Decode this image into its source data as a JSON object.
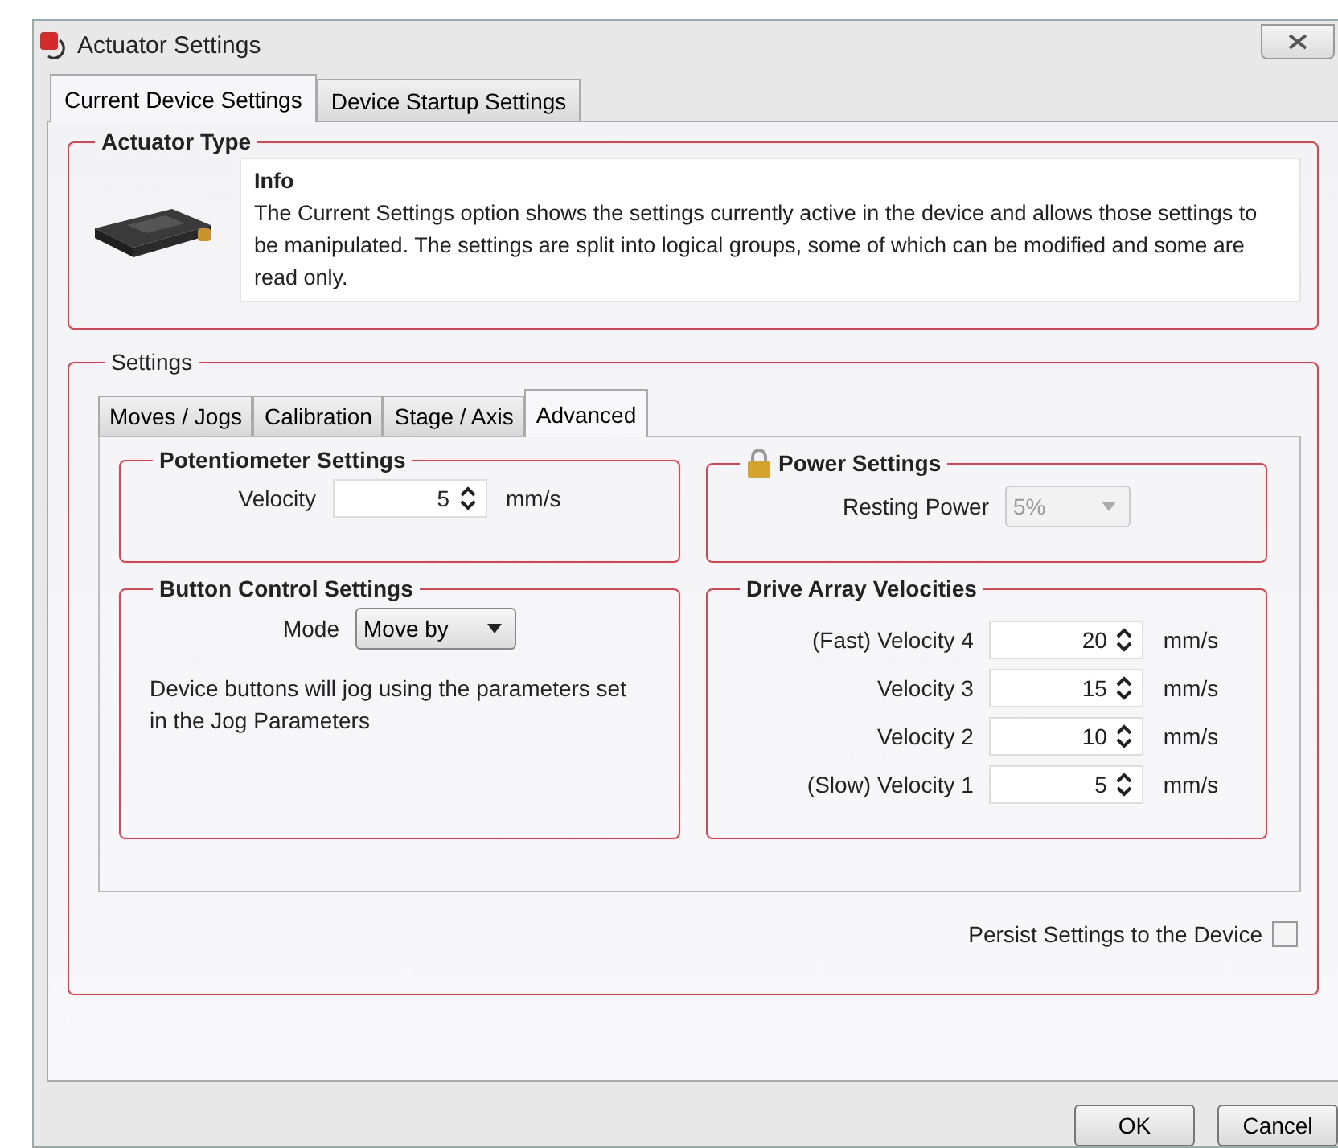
{
  "window": {
    "title": "Actuator Settings"
  },
  "tabs": [
    {
      "label": "Current Device Settings",
      "selected": true
    },
    {
      "label": "Device Startup Settings",
      "selected": false
    }
  ],
  "actuator_type": {
    "title": "Actuator Type",
    "info_title": "Info",
    "info_text": "The Current Settings option shows the settings currently active in the device and allows those settings to be manipulated. The settings are split into logical groups, some of which can be modified and some are read only."
  },
  "settings": {
    "title": "Settings",
    "tabs": [
      {
        "label": "Moves / Jogs",
        "selected": false
      },
      {
        "label": "Calibration",
        "selected": false
      },
      {
        "label": "Stage / Axis",
        "selected": false
      },
      {
        "label": "Advanced",
        "selected": true
      }
    ],
    "potentiometer": {
      "title": "Potentiometer Settings",
      "label": "Velocity",
      "value": "5",
      "unit": "mm/s"
    },
    "power": {
      "title": "Power Settings",
      "locked": true,
      "label": "Resting Power",
      "value": "5%",
      "disabled": true
    },
    "button_control": {
      "title": "Button Control Settings",
      "label": "Mode",
      "value": "Move by",
      "description": "Device buttons will jog using the parameters set in the Jog Parameters"
    },
    "drive_array": {
      "title": "Drive Array Velocities",
      "rows": [
        {
          "label": "(Fast) Velocity 4",
          "value": "20",
          "unit": "mm/s"
        },
        {
          "label": "Velocity 3",
          "value": "15",
          "unit": "mm/s"
        },
        {
          "label": "Velocity 2",
          "value": "10",
          "unit": "mm/s"
        },
        {
          "label": "(Slow) Velocity 1",
          "value": "5",
          "unit": "mm/s"
        }
      ]
    },
    "persist": {
      "label": "Persist Settings to the Device",
      "checked": false
    }
  },
  "buttons": [
    "OK",
    "Cancel"
  ]
}
